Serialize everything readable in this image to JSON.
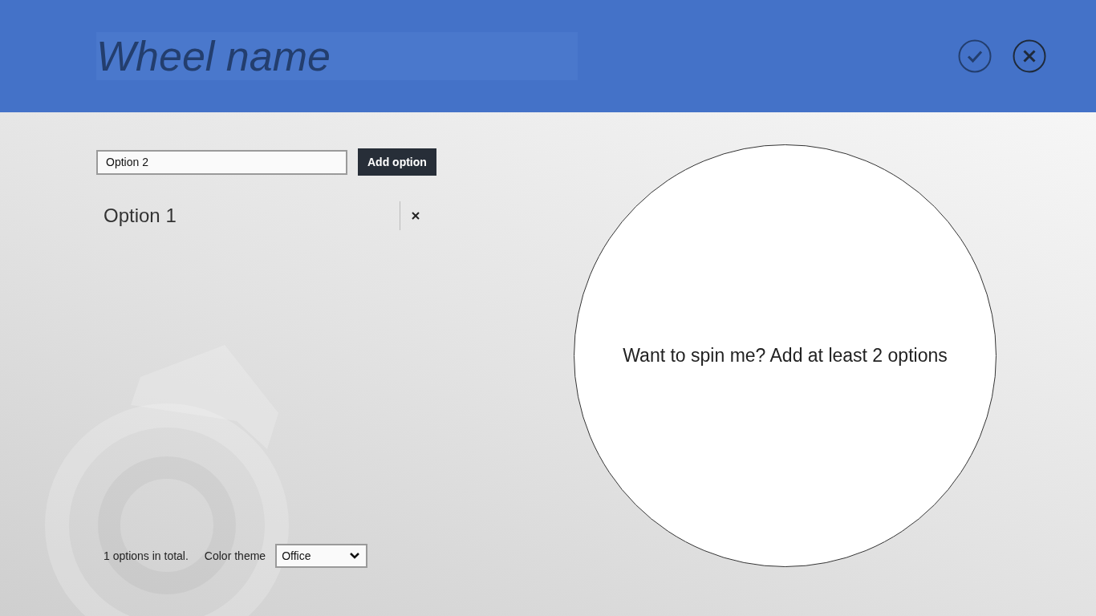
{
  "header": {
    "title_field": {
      "placeholder": "Wheel name"
    }
  },
  "new_option": {
    "field": {
      "value": "Option 2"
    },
    "button": "Add option"
  },
  "options": [
    {
      "label": "Option 1"
    }
  ],
  "footer": {
    "count": "1 options in total.",
    "theme_label": "Color theme",
    "theme_select": {
      "value": "Office"
    }
  },
  "wheel": {
    "message": "Want to spin me? Add at least 2 options"
  }
}
